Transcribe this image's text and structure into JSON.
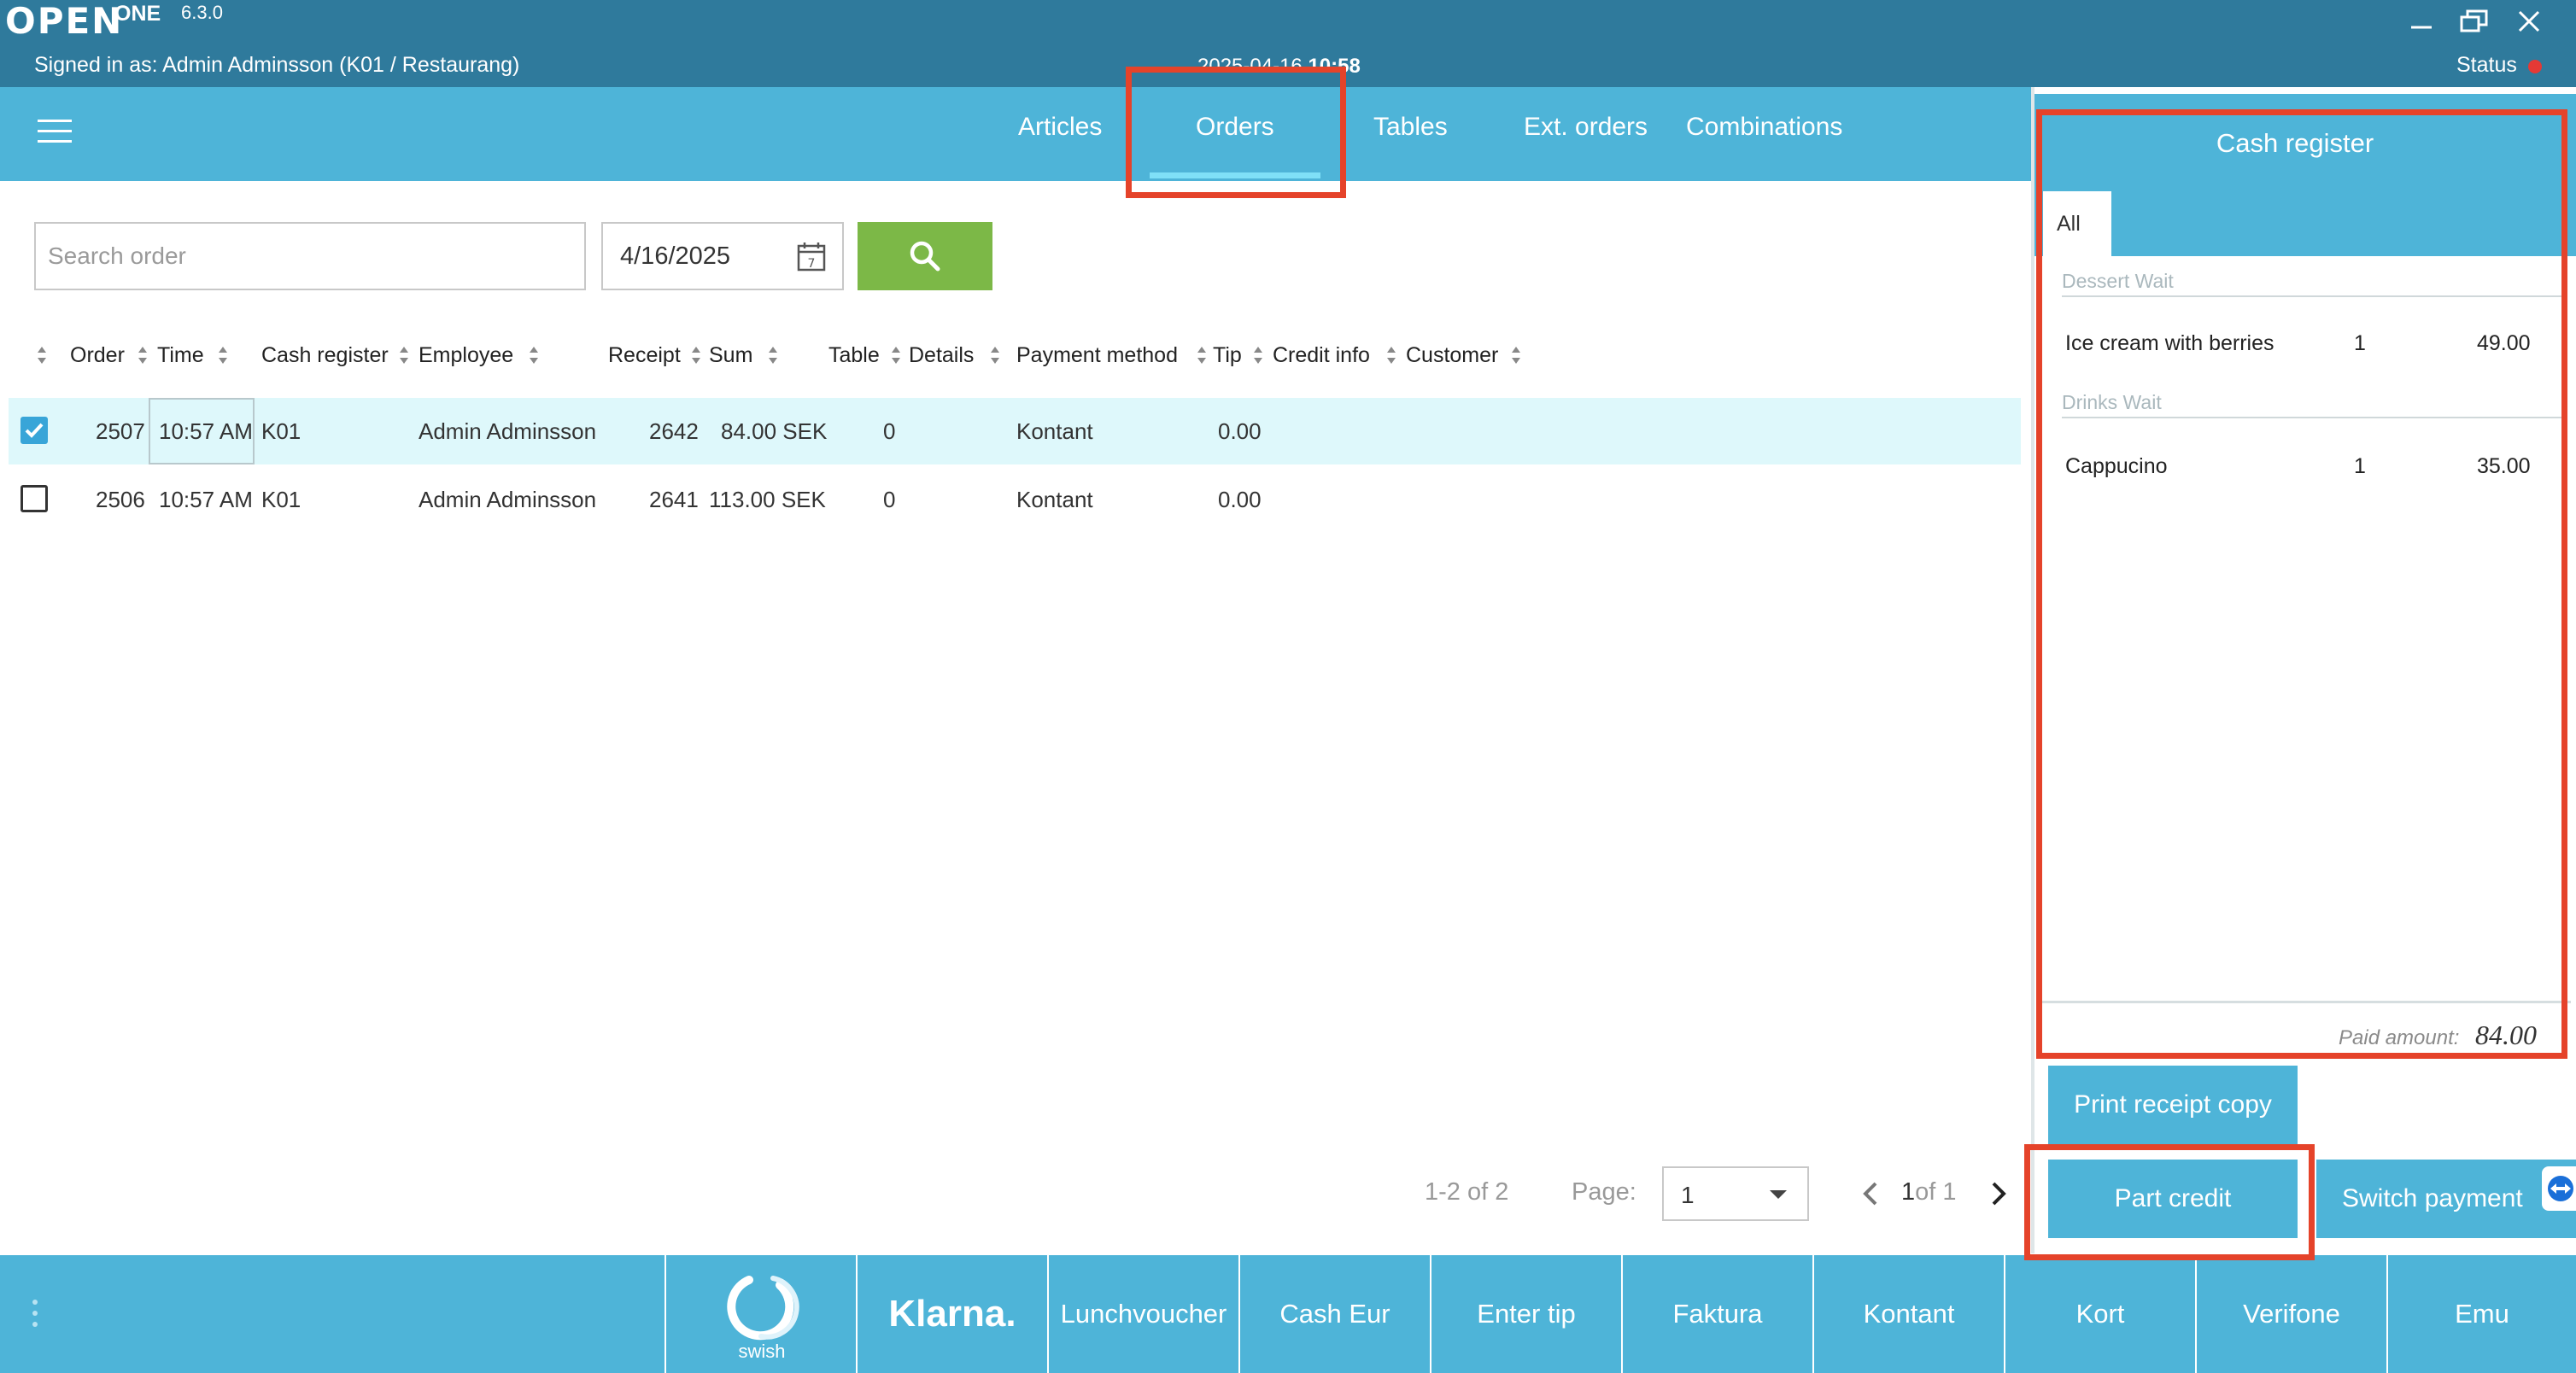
{
  "titlebar": {
    "logo": "OPEN",
    "product": "ONE",
    "version": "6.3.0",
    "signed_in": "Signed in as: Admin Adminsson (K01 / Restaurang)",
    "date": "2025-04-16",
    "time": "10:58",
    "status_label": "Status",
    "status_color": "#e53935"
  },
  "nav": {
    "tabs": [
      "Articles",
      "Orders",
      "Tables",
      "Ext. orders",
      "Combinations"
    ],
    "active_tab": "Orders"
  },
  "search": {
    "placeholder": "Search order",
    "value": "",
    "date": "4/16/2025"
  },
  "table": {
    "columns": [
      "Order",
      "Time",
      "Cash register",
      "Employee",
      "Receipt",
      "Sum",
      "Table",
      "Details",
      "Payment method",
      "Tip",
      "Credit info",
      "Customer"
    ],
    "rows": [
      {
        "checked": true,
        "order": "2507",
        "time": "10:57 AM",
        "cash_register": "K01",
        "employee": "Admin Adminsson",
        "receipt": "2642",
        "sum": "84.00 SEK",
        "table": "0",
        "details": "",
        "payment_method": "Kontant",
        "tip": "0.00",
        "credit_info": "",
        "customer": ""
      },
      {
        "checked": false,
        "order": "2506",
        "time": "10:57 AM",
        "cash_register": "K01",
        "employee": "Admin Adminsson",
        "receipt": "2641",
        "sum": "113.00 SEK",
        "table": "0",
        "details": "",
        "payment_method": "Kontant",
        "tip": "0.00",
        "credit_info": "",
        "customer": ""
      }
    ]
  },
  "pagination": {
    "range": "1-2 of 2",
    "page_label": "Page:",
    "page_value": "1",
    "current": "1",
    "of": "of 1"
  },
  "cash_register": {
    "title": "Cash register",
    "tab_all": "All",
    "groups": [
      {
        "name": "Dessert Wait",
        "items": [
          {
            "name": "Ice cream with berries",
            "qty": "1",
            "price": "49.00"
          }
        ]
      },
      {
        "name": "Drinks Wait",
        "items": [
          {
            "name": "Cappucino",
            "qty": "1",
            "price": "35.00"
          }
        ]
      }
    ],
    "paid_label": "Paid amount:",
    "paid_value": "84.00"
  },
  "actions": {
    "print_receipt": "Print receipt copy",
    "part_credit": "Part credit",
    "switch_payment": "Switch payment"
  },
  "payment_methods": [
    "swish",
    "Klarna.",
    "Lunchvoucher",
    "Cash Eur",
    "Enter tip",
    "Faktura",
    "Kontant",
    "Kort",
    "Verifone",
    "Emu"
  ],
  "colors": {
    "titlebar": "#2f7a9c",
    "accent": "#4eb4d8",
    "search_button": "#7cb847",
    "selected_row": "#def8fb",
    "highlight": "#e5432a"
  }
}
